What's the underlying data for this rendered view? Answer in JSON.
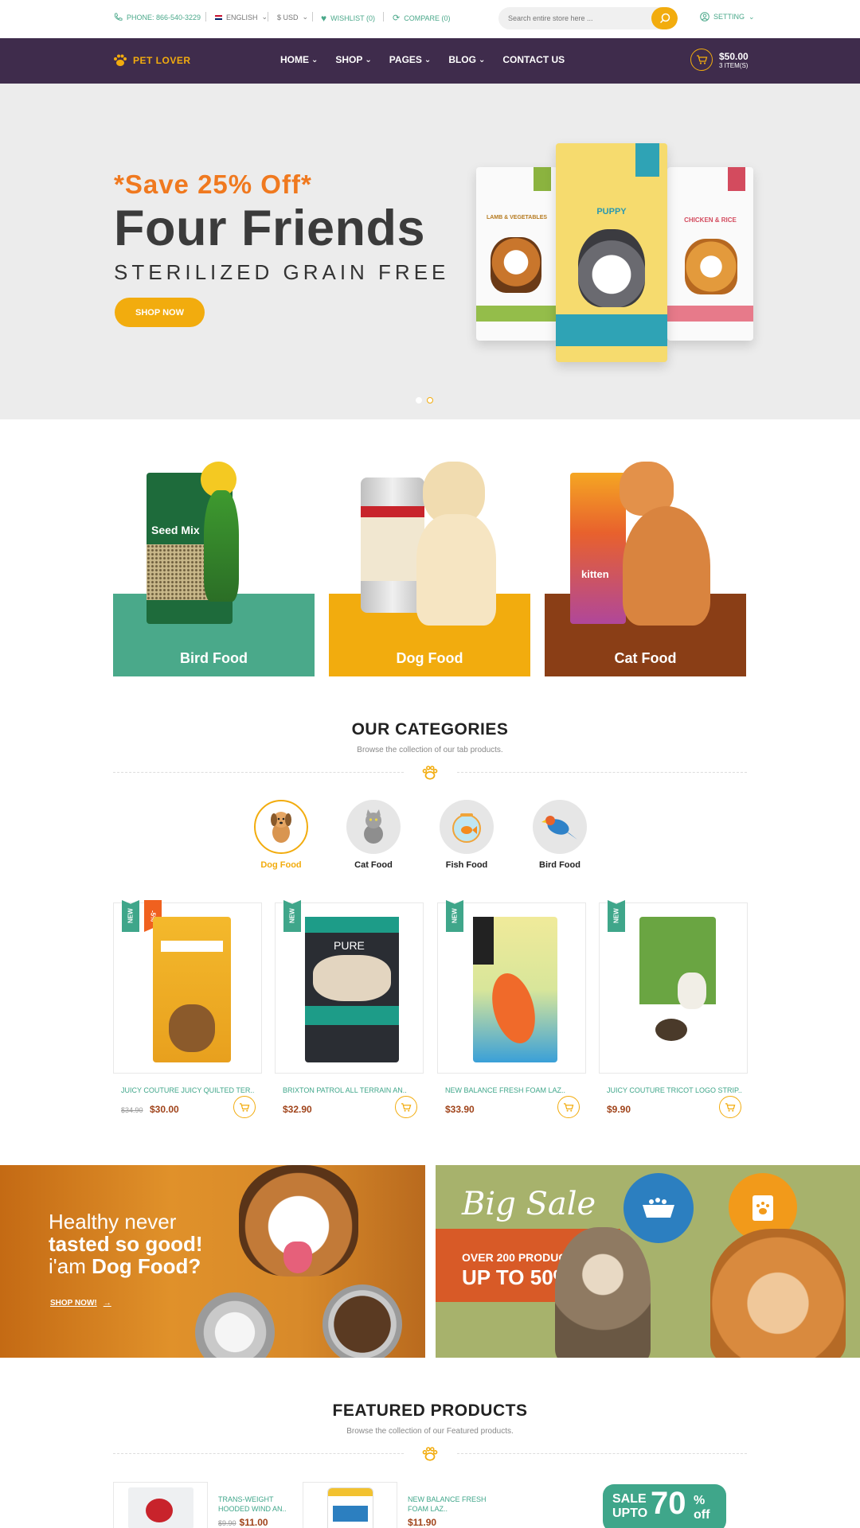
{
  "topbar": {
    "phone": "PHONE: 866-540-3229",
    "language": "ENGLISH",
    "currency": "$ USD",
    "wishlist": "WISHLIST (0)",
    "compare": "COMPARE (0)",
    "search_placeholder": "Search entire store here ...",
    "setting": "SETTING"
  },
  "nav": {
    "logo_text": "PET LOVER",
    "menu": [
      "HOME",
      "SHOP",
      "PAGES",
      "BLOG",
      "CONTACT US"
    ],
    "cart_total": "$50.00",
    "cart_items": "3 ITEM(S)"
  },
  "hero": {
    "save": "*Save 25% Off*",
    "title": "Four Friends",
    "subtitle": "STERILIZED GRAIN FREE",
    "cta": "SHOP NOW",
    "bags": [
      "LAMB & VEGETABLES",
      "PUPPY",
      "CHICKEN & RICE"
    ]
  },
  "food_banners": [
    {
      "label": "Bird Food",
      "color": "#4aa98a"
    },
    {
      "label": "Dog Food",
      "color": "#f2ac0e"
    },
    {
      "label": "Cat Food",
      "color": "#8a3e16"
    }
  ],
  "categories": {
    "title": "OUR CATEGORIES",
    "subtitle": "Browse the collection of our tab products.",
    "tabs": [
      "Dog Food",
      "Cat Food",
      "Fish Food",
      "Bird Food"
    ],
    "active_tab": "Dog Food"
  },
  "products": [
    {
      "badge": "NEW",
      "discount": "-5%",
      "name": "JUICY COUTURE JUICY QUILTED TER..",
      "old_price": "$34.90",
      "price": "$30.00"
    },
    {
      "badge": "NEW",
      "name": "BRIXTON PATROL ALL TERRAIN AN..",
      "price": "$32.90"
    },
    {
      "badge": "NEW",
      "name": "NEW BALANCE FRESH FOAM LAZ..",
      "price": "$33.90"
    },
    {
      "badge": "NEW",
      "name": "JUICY COUTURE TRICOT LOGO STRIP..",
      "price": "$9.90"
    }
  ],
  "promo_left": {
    "line1": "Healthy never",
    "line2": "tasted so good!",
    "line3_prefix": "i'am ",
    "line3_bold": "Dog Food?",
    "link": "SHOP NOW!"
  },
  "promo_right": {
    "title": "Big Sale",
    "line1": "OVER 200 PRODUCTS",
    "line2": "UP TO 50%"
  },
  "featured": {
    "title": "FEATURED PRODUCTS",
    "subtitle": "Browse the collection of our Featured products.",
    "items": [
      {
        "name": "TRANS-WEIGHT HOODED WIND AN..",
        "old_price": "$9.90",
        "price": "$11.00"
      },
      {
        "name": "NEW BALANCE FRESH FOAM LAZ..",
        "price": "$11.90"
      }
    ],
    "sale_tag": {
      "sale": "SALE",
      "upto": "UPTO",
      "percent": "70",
      "pct_sign": "%",
      "off": "off"
    }
  },
  "colors": {
    "accent": "#f2ac0e",
    "green": "#4aa98a",
    "nav": "#3f2c4c",
    "orange": "#f0791f"
  }
}
